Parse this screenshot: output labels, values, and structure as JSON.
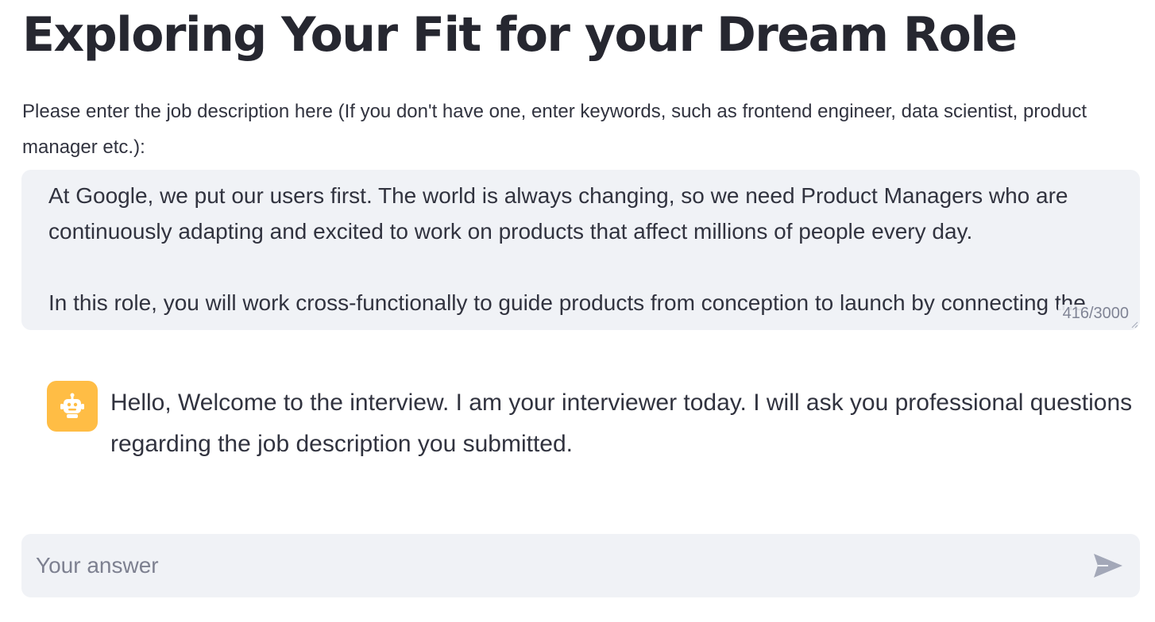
{
  "page": {
    "title": "Exploring Your Fit for your Dream Role"
  },
  "job_description": {
    "label": "Please enter the job description here (If you don't have one, enter keywords, such as frontend engineer, data scientist, product manager etc.):",
    "value": "At Google, we put our users first. The world is always changing, so we need Product Managers who are continuously adapting and excited to work on products that affect millions of people every day.\n\nIn this role, you will work cross-functionally to guide products from conception to launch by connecting the technical and business worlds. You can break down complex problems into steps that drive product development.",
    "char_count": "416/3000"
  },
  "chat": {
    "messages": [
      {
        "role": "assistant",
        "avatar_icon": "robot-icon",
        "text": "Hello, Welcome to the interview. I am your interviewer today. I will ask you professional questions regarding the job description you submitted."
      }
    ],
    "input": {
      "placeholder": "Your answer",
      "value": ""
    },
    "send_icon": "send-icon"
  },
  "colors": {
    "avatar_bg": "#ffbd45",
    "input_bg": "#f0f2f6",
    "text": "#31333f"
  }
}
